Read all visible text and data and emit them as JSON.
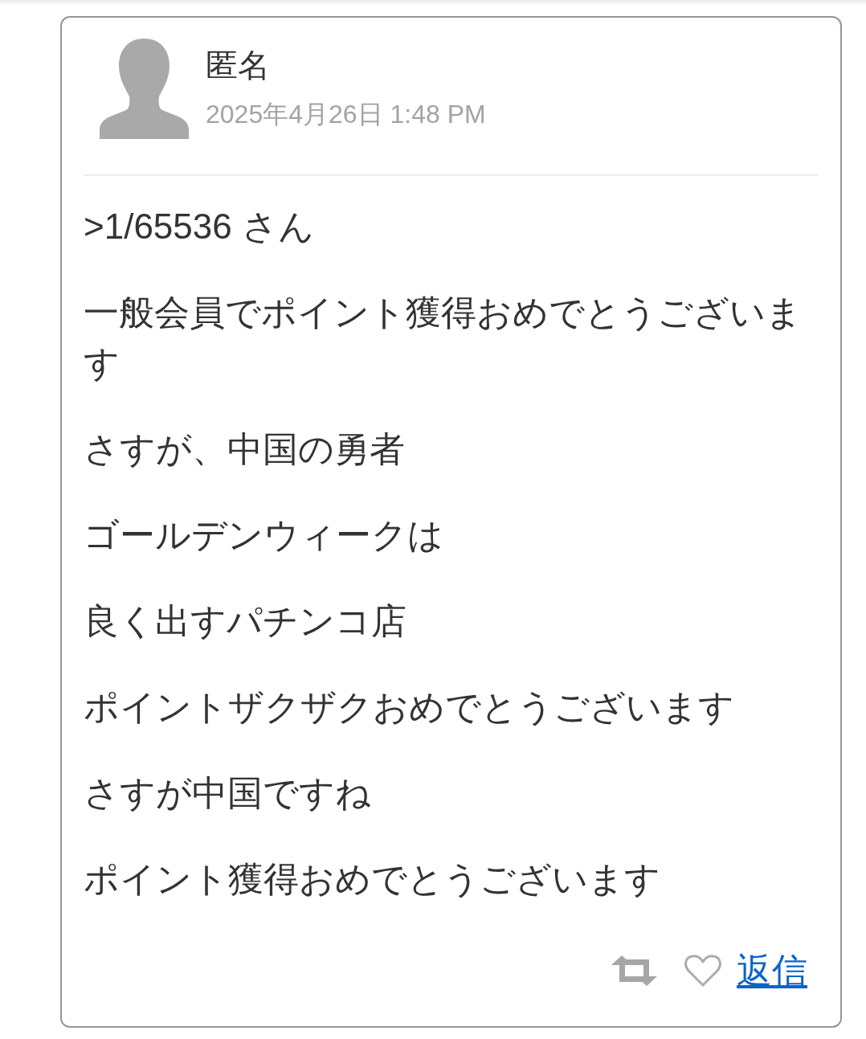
{
  "post": {
    "author": "匿名",
    "timestamp": "2025年4月26日 1:48 PM",
    "paragraphs": [
      ">1/65536 さん",
      "一般会員でポイント獲得おめでとうございます",
      "さすが、中国の勇者",
      "ゴールデンウィークは",
      "良く出すパチンコ店",
      "ポイントザクザクおめでとうございます",
      "さすが中国ですね",
      "ポイント獲得おめでとうございます"
    ],
    "actions": {
      "liked": false,
      "reply": "返信"
    }
  }
}
